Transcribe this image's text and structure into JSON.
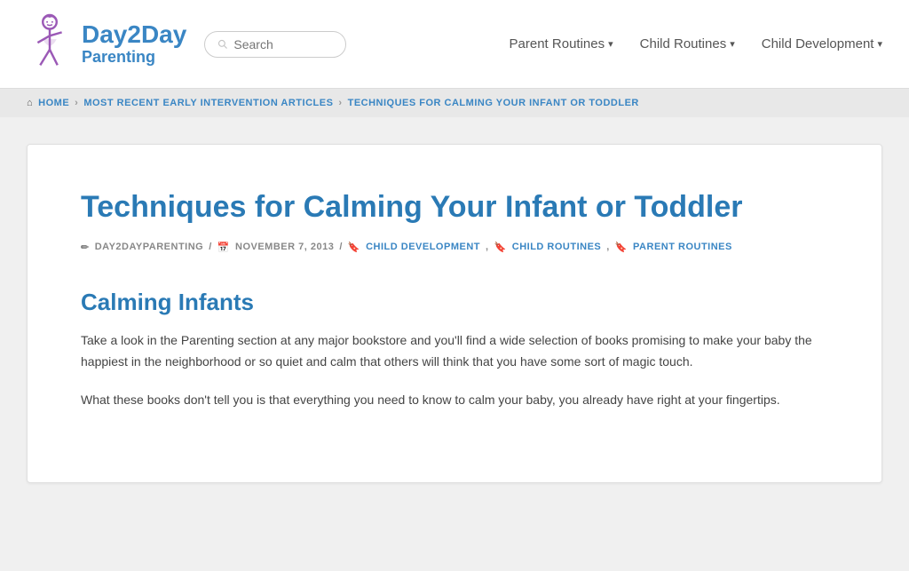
{
  "header": {
    "logo_name": "Day2Day",
    "logo_sub": "Parenting",
    "search_placeholder": "Search",
    "nav_items": [
      {
        "label": "Parent Routines",
        "has_dropdown": true
      },
      {
        "label": "Child Routines",
        "has_dropdown": true
      },
      {
        "label": "Child Development",
        "has_dropdown": true
      }
    ]
  },
  "breadcrumb": {
    "home": "HOME",
    "sep1": "›",
    "crumb2": "MOST RECENT EARLY INTERVENTION ARTICLES",
    "sep2": "›",
    "crumb3": "TECHNIQUES FOR CALMING YOUR INFANT OR TODDLER"
  },
  "article": {
    "title": "Techniques for Calming Your Infant or Toddler",
    "meta_author": "DAY2DAYPARENTING",
    "meta_date": "NOVEMBER 7, 2013",
    "meta_tags": [
      {
        "label": "CHILD DEVELOPMENT"
      },
      {
        "label": "CHILD ROUTINES"
      },
      {
        "label": "PARENT ROUTINES"
      }
    ],
    "section_title": "Calming Infants",
    "body_p1": "Take a look in the Parenting section at any major bookstore and you'll find a wide selection of books promising to make your baby the happiest in the neighborhood or so quiet and calm that others will think that you have some sort of magic touch.",
    "body_p2": "What these books don't tell you is that everything you need to know to calm your baby, you already have right at your fingertips."
  }
}
